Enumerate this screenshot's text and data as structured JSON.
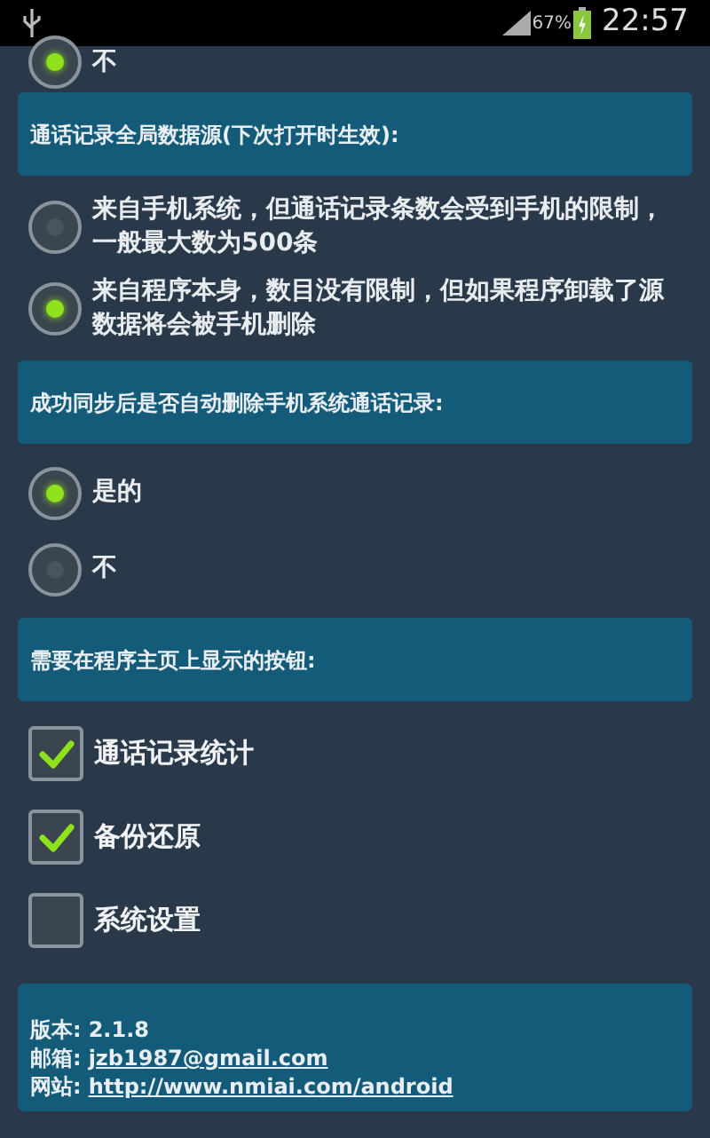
{
  "status_bar": {
    "battery": "67%",
    "time": "22:57"
  },
  "items": [
    {
      "kind": "radio",
      "label": "不",
      "selected": true
    },
    {
      "kind": "header",
      "label": "通话记录全局数据源(下次打开时生效):"
    },
    {
      "kind": "radio",
      "label": "来自手机系统，但通话记录条数会受到手机的限制，一般最大数为500条",
      "selected": false
    },
    {
      "kind": "radio",
      "label": "来自程序本身，数目没有限制，但如果程序卸载了源数据将会被手机删除",
      "selected": true
    },
    {
      "kind": "header",
      "label": "成功同步后是否自动删除手机系统通话记录:"
    },
    {
      "kind": "radio",
      "label": "是的",
      "selected": true
    },
    {
      "kind": "radio",
      "label": "不",
      "selected": false
    },
    {
      "kind": "header",
      "label": "需要在程序主页上显示的按钮:"
    },
    {
      "kind": "checkbox",
      "label": "通话记录统计",
      "checked": true
    },
    {
      "kind": "checkbox",
      "label": "备份还原",
      "checked": true
    },
    {
      "kind": "checkbox",
      "label": "系统设置",
      "checked": false
    }
  ],
  "footer": [
    {
      "label": "版本:",
      "value": "2.1.8",
      "link": false
    },
    {
      "label": "邮箱:",
      "value": "jzb1987@gmail.com",
      "link": true
    },
    {
      "label": "网站:",
      "value": "http://www.nmiai.com/android",
      "link": true
    }
  ]
}
